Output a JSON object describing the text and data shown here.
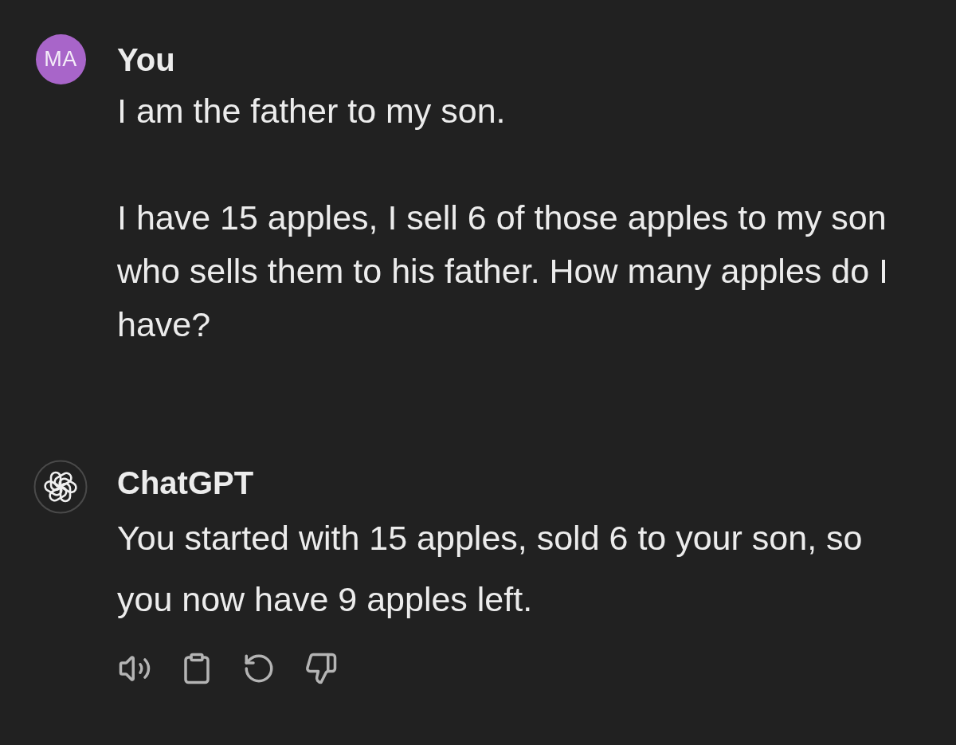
{
  "messages": [
    {
      "kind": "user",
      "avatar": "MA",
      "author": "You",
      "paragraphs": [
        "I am the father to my son.",
        "I have 15 apples, I sell 6 of those apples to my son who sells them to his father. How many apples do I have?"
      ]
    },
    {
      "kind": "assistant",
      "author": "ChatGPT",
      "paragraphs": [
        "You started with 15 apples, sold 6 to your son, so you now have 9 apples left."
      ]
    }
  ]
}
